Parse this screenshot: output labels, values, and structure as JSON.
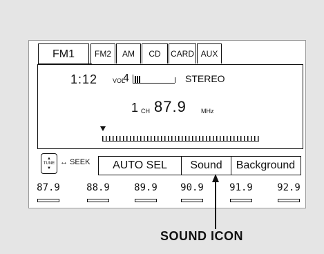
{
  "tabs": [
    "FM1",
    "FM2",
    "AM",
    "CD",
    "CARD",
    "AUX"
  ],
  "display": {
    "time": "1:12",
    "vol_label": "VOL",
    "vol_value": "4",
    "stereo": "STEREO",
    "channel": "1",
    "ch_label": "CH",
    "frequency": "87.9",
    "unit": "MHz"
  },
  "controls": {
    "tune_label": "TUNE",
    "seek_label": "↔ SEEK",
    "buttons": [
      "AUTO SEL",
      "Sound",
      "Background"
    ]
  },
  "presets": [
    "87.9",
    "88.9",
    "89.9",
    "90.9",
    "91.9",
    "92.9"
  ],
  "callout": "SOUND ICON"
}
